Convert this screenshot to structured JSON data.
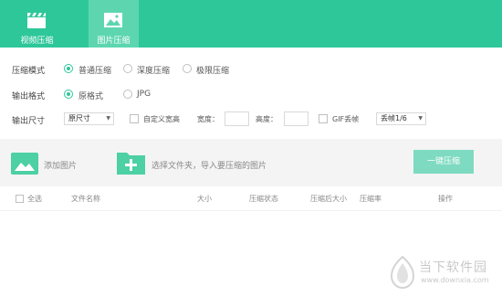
{
  "tabs": [
    {
      "label": "视频压缩",
      "icon": "clapperboard-icon",
      "active": false
    },
    {
      "label": "图片压缩",
      "icon": "image-icon",
      "active": true
    }
  ],
  "compress_mode": {
    "label": "压缩模式",
    "options": [
      "普通压缩",
      "深度压缩",
      "极限压缩"
    ],
    "selected": "普通压缩"
  },
  "output_format": {
    "label": "输出格式",
    "options": [
      "原格式",
      "JPG"
    ],
    "selected": "原格式"
  },
  "output_size": {
    "label": "输出尺寸",
    "size_select": "原尺寸",
    "custom_label": "自定义宽高",
    "width_label": "宽度：",
    "height_label": "高度：",
    "gif_label": "GIF丢帧",
    "frame_select": "丢帧1/6"
  },
  "actions": {
    "add_image": "添加图片",
    "add_folder": "选择文件夹，导入要压缩的图片",
    "one_click": "一键压缩"
  },
  "table": {
    "select_all": "全选",
    "columns": [
      "文件名称",
      "大小",
      "压缩状态",
      "压缩后大小",
      "压缩率",
      "操作"
    ]
  },
  "watermark": {
    "title": "当下软件园",
    "url": "www.downxia.com"
  },
  "colors": {
    "accent": "#2ec79a",
    "accent_light": "#7edac0"
  }
}
